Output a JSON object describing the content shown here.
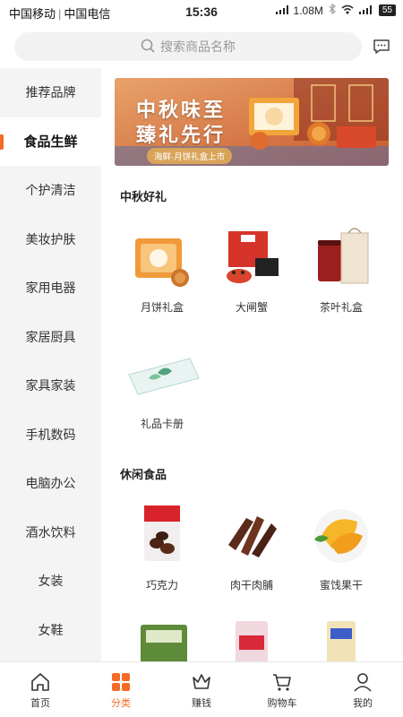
{
  "status_bar": {
    "carrier1": "中国移动",
    "carrier2": "中国电信",
    "time": "15:36",
    "speed": "1.08M",
    "battery": "55"
  },
  "search": {
    "placeholder": "搜索商品名称"
  },
  "sidebar": {
    "items": [
      {
        "label": "推荐品牌"
      },
      {
        "label": "食品生鲜",
        "active": true
      },
      {
        "label": "个护清洁"
      },
      {
        "label": "美妆护肤"
      },
      {
        "label": "家用电器"
      },
      {
        "label": "家居厨具"
      },
      {
        "label": "家具家装"
      },
      {
        "label": "手机数码"
      },
      {
        "label": "电脑办公"
      },
      {
        "label": "酒水饮料"
      },
      {
        "label": "女装"
      },
      {
        "label": "女鞋"
      }
    ]
  },
  "banner": {
    "line1": "中秋味至",
    "line2": "臻礼先行",
    "tag": "海鲜·月饼礼盒上市"
  },
  "sections": [
    {
      "title": "中秋好礼",
      "products": [
        {
          "name": "月饼礼盒",
          "icon": "mooncake-box"
        },
        {
          "name": "大闸蟹",
          "icon": "crab-gift-box"
        },
        {
          "name": "茶叶礼盒",
          "icon": "tea-gift-box"
        },
        {
          "name": "礼品卡册",
          "icon": "gift-card-booklet"
        }
      ]
    },
    {
      "title": "休闲食品",
      "products": [
        {
          "name": "巧克力",
          "icon": "chocolate"
        },
        {
          "name": "肉干肉脯",
          "icon": "jerky"
        },
        {
          "name": "蜜饯果干",
          "icon": "dried-mango"
        },
        {
          "name": "",
          "icon": "seaweed-snack"
        },
        {
          "name": "",
          "icon": "candy-pack"
        },
        {
          "name": "",
          "icon": "biscuit-roll"
        }
      ]
    }
  ],
  "tabbar": {
    "items": [
      {
        "label": "首页",
        "icon": "home-icon"
      },
      {
        "label": "分类",
        "icon": "category-icon",
        "active": true
      },
      {
        "label": "赚钱",
        "icon": "crown-icon"
      },
      {
        "label": "购物车",
        "icon": "cart-icon"
      },
      {
        "label": "我的",
        "icon": "user-icon"
      }
    ]
  },
  "colors": {
    "accent": "#f56a25",
    "sidebar_bg": "#f4f4f4"
  }
}
